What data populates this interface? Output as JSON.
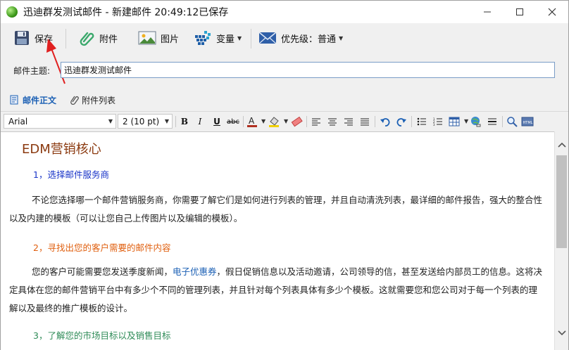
{
  "window": {
    "title": "迅迪群发测试邮件 - 新建邮件 20:49:12已保存",
    "icon": "globe-icon"
  },
  "toolbar": {
    "save_label": "保存",
    "attach_label": "附件",
    "image_label": "图片",
    "variable_label": "变量",
    "priority_label": "优先级：普通"
  },
  "subject": {
    "label": "邮件主题:",
    "value": "迅迪群发测试邮件"
  },
  "tabs": {
    "body_label": "邮件正文",
    "attach_list_label": "附件列表"
  },
  "format": {
    "font_name": "Arial",
    "font_size": "2 (10 pt)",
    "accent_color": "#c0392b"
  },
  "content": {
    "heading": "EDM营销核心",
    "s1_title": "1，选择邮件服务商",
    "s1_color": "#1a35c8",
    "s1_para": "不论您选择哪一个邮件营销服务商，你需要了解它们是如何进行列表的管理，并且自动清洗列表，最详细的邮件报告，强大的整合性以及内建的模板（可以让您自己上传图片以及编辑的模板）。",
    "s2_title": "2，寻找出您的客户需要的邮件内容",
    "s2_color": "#e06010",
    "s2_para_a": "您的客户可能需要您发送季度新闻，",
    "s2_link": "电子优惠券",
    "s2_para_b": "，假日促销信息以及活动邀请，公司领导的信，甚至发送给内部员工的信息。这将决定具体在您的邮件营销平台中有多少个不同的管理列表，并且针对每个列表具体有多少个模板。这就需要您和您公司对于每一个列表的理解以及最终的推广模板的设计。",
    "s3_title": "3，了解您的市场目标以及销售目标",
    "s3_color": "#2e8b57"
  }
}
